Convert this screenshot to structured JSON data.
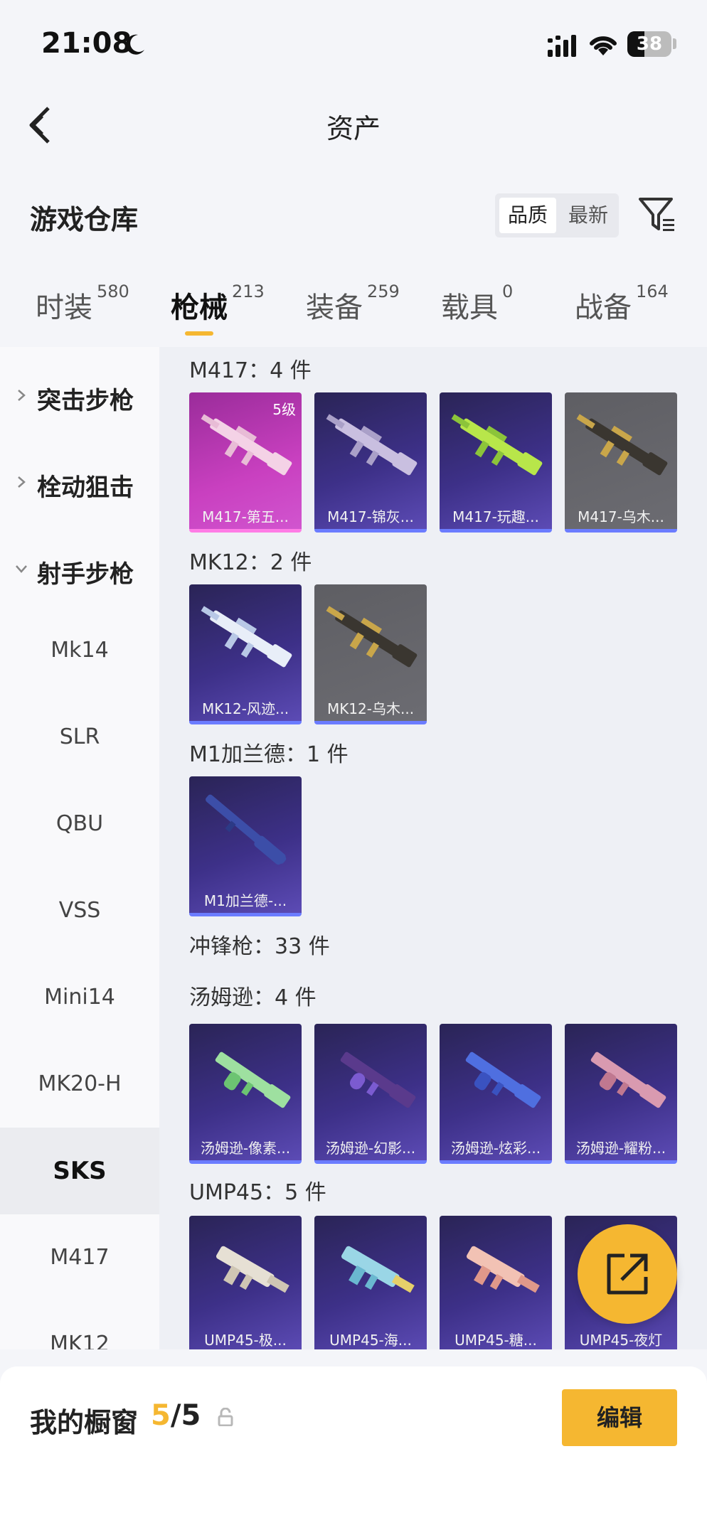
{
  "status_bar": {
    "time": "21:08",
    "battery": "38"
  },
  "header": {
    "title": "资产"
  },
  "warehouse": {
    "title": "游戏仓库"
  },
  "sort": {
    "options": [
      "品质",
      "最新"
    ],
    "selected": "品质"
  },
  "tabs": [
    {
      "label": "时装",
      "count": "580"
    },
    {
      "label": "枪械",
      "count": "213"
    },
    {
      "label": "装备",
      "count": "259"
    },
    {
      "label": "载具",
      "count": "0"
    },
    {
      "label": "战备",
      "count": "164"
    }
  ],
  "active_tab": "枪械",
  "sidebar": {
    "categories": [
      "突击步枪",
      "栓动狙击",
      "射手步枪"
    ],
    "subitems": [
      "Mk14",
      "SLR",
      "QBU",
      "VSS",
      "Mini14",
      "MK20-H",
      "SKS",
      "M417",
      "MK12"
    ],
    "active_subitem": "SKS"
  },
  "groups": {
    "m417": {
      "title": "M417：4 件",
      "level_badge": "5级",
      "items": [
        "M417-第五...",
        "M417-锦灰...",
        "M417-玩趣...",
        "M417-乌木..."
      ]
    },
    "mk12": {
      "title": "MK12：2 件",
      "items": [
        "MK12-风迹...",
        "MK12-乌木..."
      ]
    },
    "m1": {
      "title": "M1加兰德：1 件",
      "items": [
        "M1加兰德-..."
      ]
    },
    "smg": {
      "title": "冲锋枪：33 件"
    },
    "thompson": {
      "title": "汤姆逊：4 件",
      "items": [
        "汤姆逊-像素...",
        "汤姆逊-幻影...",
        "汤姆逊-炫彩...",
        "汤姆逊-耀粉..."
      ]
    },
    "ump45": {
      "title": "UMP45：5 件",
      "items": [
        "UMP45-极...",
        "UMP45-海...",
        "UMP45-糖...",
        "UMP45-夜灯"
      ]
    }
  },
  "bottom_bar": {
    "label": "我的橱窗",
    "current": "5",
    "total": "/5",
    "edit_label": "编辑"
  },
  "colors": {
    "accent": "#f5b731",
    "card_purple": "#3d3088",
    "card_pink": "#c940c0",
    "card_grey": "#6c6c72"
  }
}
